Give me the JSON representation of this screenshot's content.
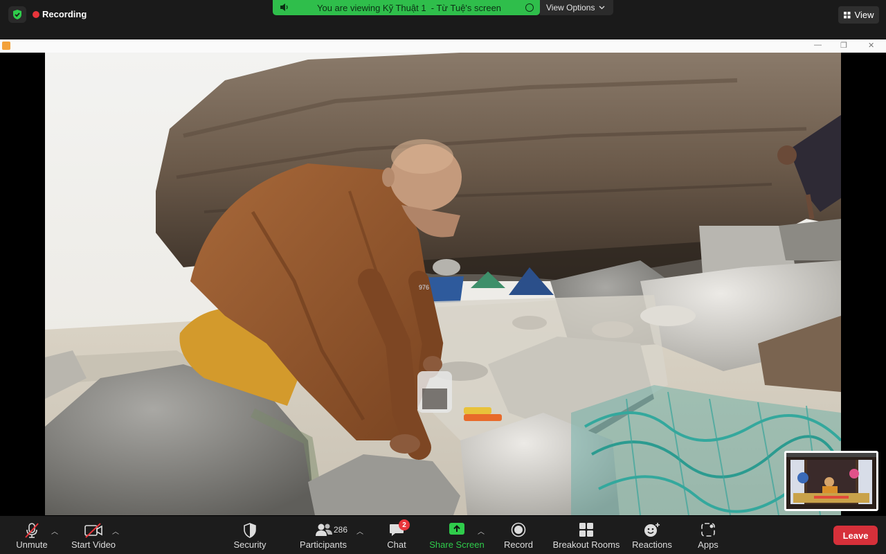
{
  "topbar": {
    "recording_label": "Recording",
    "viewing_label": "You are viewing Kỹ Thuật 1  - Từ Tuệ's screen",
    "view_options_label": "View Options",
    "view_label": "View"
  },
  "toolbar": {
    "unmute_label": "Unmute",
    "start_video_label": "Start Video",
    "security_label": "Security",
    "participants_label": "Participants",
    "participants_count": "286",
    "chat_label": "Chat",
    "chat_badge": "2",
    "share_screen_label": "Share Screen",
    "record_label": "Record",
    "breakout_rooms_label": "Breakout Rooms",
    "reactions_label": "Reactions",
    "apps_label": "Apps",
    "leave_label": "Leave"
  },
  "shared_content": {
    "boat_marking": "976"
  },
  "colors": {
    "share_green": "#2fcc4b",
    "banner_green": "#2fbe4b",
    "leave_red": "#d6303a",
    "recording_red": "#e8353b"
  }
}
